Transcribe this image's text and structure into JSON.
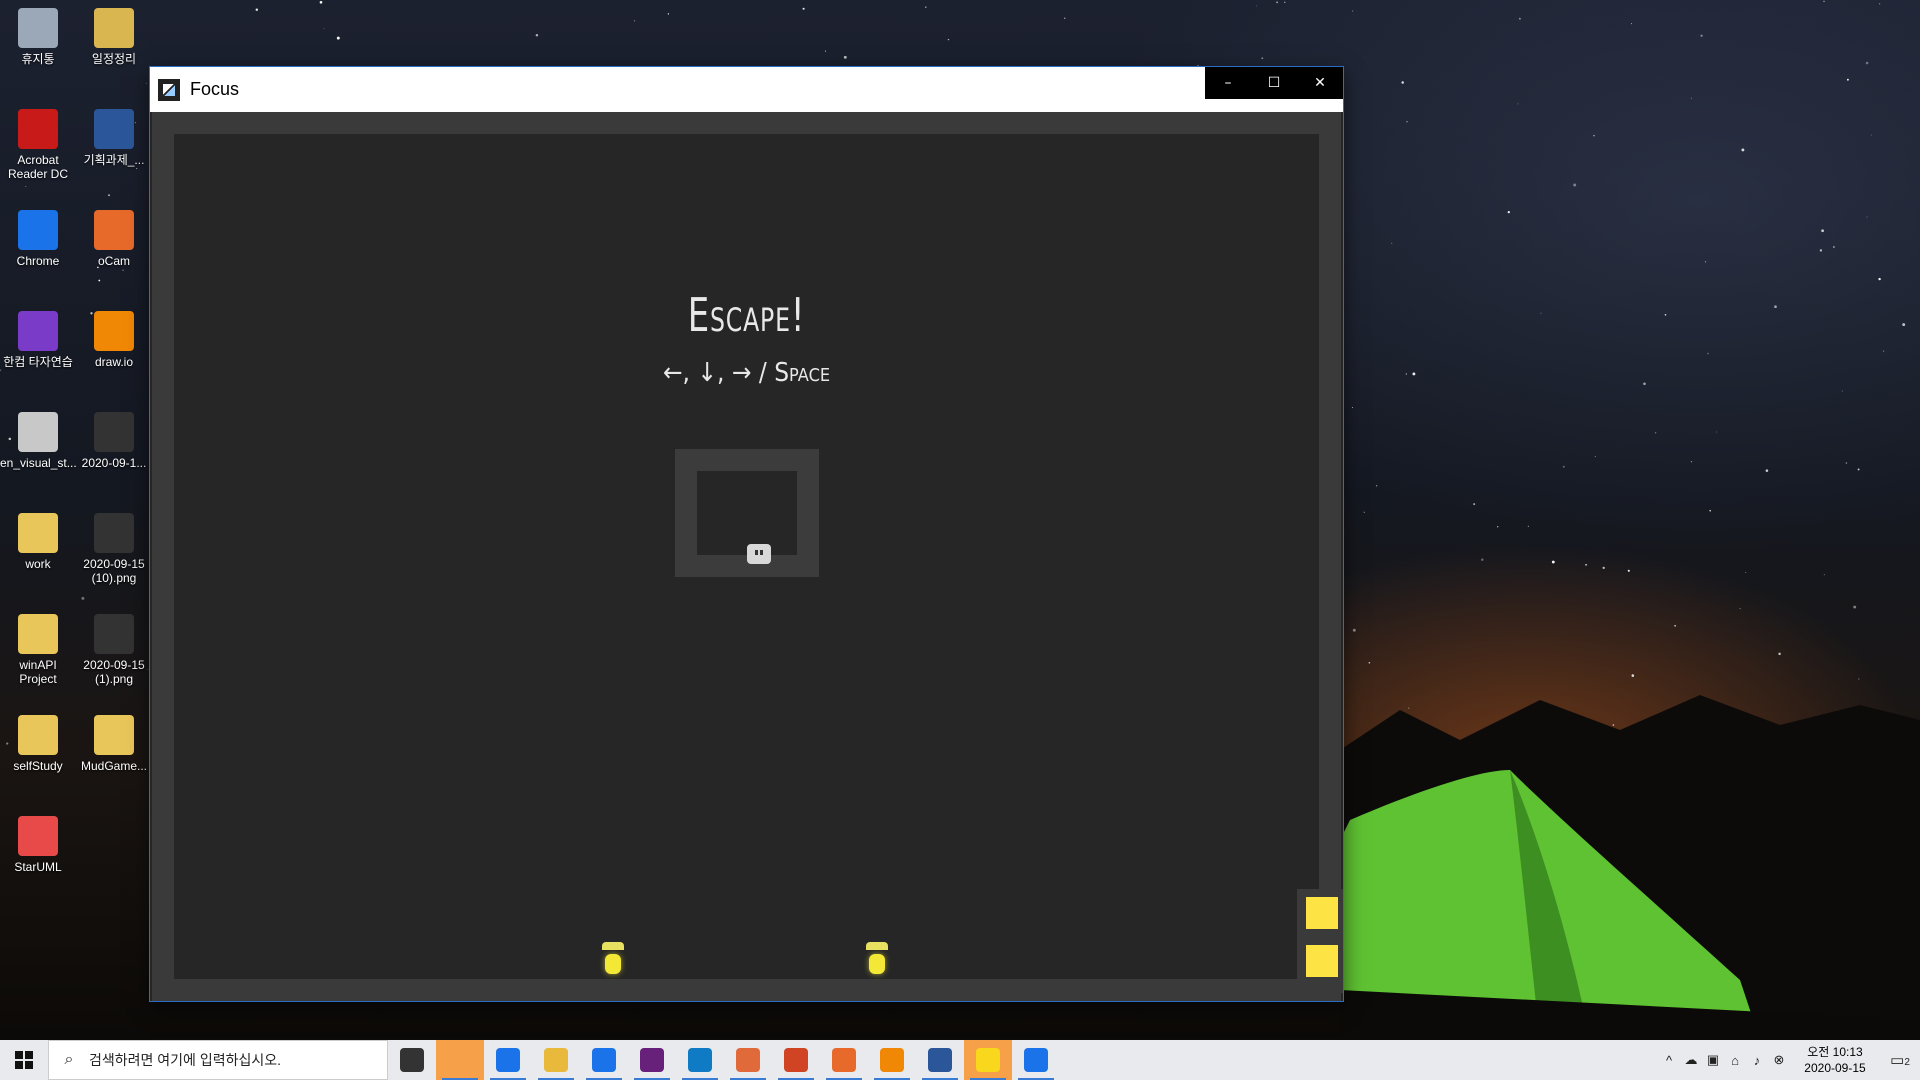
{
  "desktop": {
    "icons": [
      {
        "label": "휴지통",
        "icon": "recycle-bin-icon",
        "color": "#9aa8b8"
      },
      {
        "label": "일정정리",
        "icon": "folder-icon",
        "color": "#d9b64f"
      },
      {
        "label": "Acrobat Reader DC",
        "icon": "acrobat-icon",
        "color": "#c91a1a"
      },
      {
        "label": "기획과제_...",
        "icon": "word-doc-icon",
        "color": "#2b579a"
      },
      {
        "label": "Chrome",
        "icon": "chrome-icon",
        "color": "#1a73e8"
      },
      {
        "label": "oCam",
        "icon": "ocam-icon",
        "color": "#e86a2a"
      },
      {
        "label": "한컴 타자연습",
        "icon": "hancom-typing-icon",
        "color": "#7a3cc8"
      },
      {
        "label": "draw.io",
        "icon": "drawio-icon",
        "color": "#f08705"
      },
      {
        "label": "en_visual_st...",
        "icon": "disc-image-icon",
        "color": "#c8c8c8"
      },
      {
        "label": "2020-09-1...",
        "icon": "image-file-icon",
        "color": "#333333"
      },
      {
        "label": "work",
        "icon": "folder-icon",
        "color": "#e8c65a"
      },
      {
        "label": "2020-09-15 (10).png",
        "icon": "image-file-icon",
        "color": "#333333"
      },
      {
        "label": "winAPI Project",
        "icon": "folder-icon",
        "color": "#e8c65a"
      },
      {
        "label": "2020-09-15 (1).png",
        "icon": "image-file-icon",
        "color": "#333333"
      },
      {
        "label": "selfStudy",
        "icon": "folder-icon",
        "color": "#e8c65a"
      },
      {
        "label": "MudGame...",
        "icon": "folder-icon",
        "color": "#e8c65a"
      },
      {
        "label": "StarUML",
        "icon": "staruml-icon",
        "color": "#e84a4a"
      }
    ]
  },
  "window": {
    "title": "Focus",
    "controls": {
      "minimize": "–",
      "maximize": "☐",
      "close": "✕"
    }
  },
  "game": {
    "title": "Escape!",
    "controls_hint": "←, ↓, → / Space",
    "colors": {
      "background": "#262626",
      "wall": "#3a3a3a",
      "lamp": "#f2e835",
      "exit": "#fde444",
      "player": "#d8d8d8"
    }
  },
  "taskbar": {
    "search_placeholder": "검색하려면 여기에 입력하십시오.",
    "apps": [
      {
        "name": "task-view-icon",
        "color": "#333333"
      },
      {
        "name": "sticky-notes-icon",
        "color": "#f7a04a"
      },
      {
        "name": "chrome-icon",
        "color": "#1a73e8"
      },
      {
        "name": "file-explorer-icon",
        "color": "#e8b93a"
      },
      {
        "name": "maps-icon",
        "color": "#1a73e8"
      },
      {
        "name": "visual-studio-icon",
        "color": "#68217a"
      },
      {
        "name": "edge-icon",
        "color": "#0f7bc4"
      },
      {
        "name": "game-app-icon",
        "color": "#e06a3a"
      },
      {
        "name": "powerpoint-icon",
        "color": "#d04423"
      },
      {
        "name": "ocam-icon",
        "color": "#e86a2a"
      },
      {
        "name": "drawio-icon",
        "color": "#f08705"
      },
      {
        "name": "word-icon",
        "color": "#2b579a"
      },
      {
        "name": "kakaotalk-icon",
        "color": "#f9d71c"
      },
      {
        "name": "remote-app-icon",
        "color": "#1a73e8"
      }
    ],
    "clock": {
      "time": "오전 10:13",
      "date": "2020-09-15"
    },
    "notification_count": "2"
  }
}
